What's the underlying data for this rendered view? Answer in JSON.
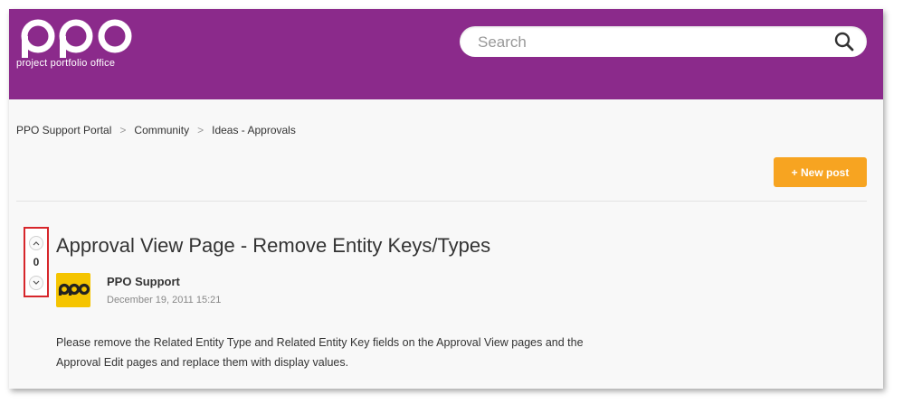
{
  "header": {
    "logo_text": "ppo",
    "logo_subtitle": "project portfolio office",
    "search_placeholder": "Search"
  },
  "breadcrumb": [
    "PPO Support Portal",
    "Community",
    "Ideas - Approvals"
  ],
  "breadcrumb_separator": ">",
  "actions": {
    "new_post_label": "+ New post"
  },
  "post": {
    "vote_count": "0",
    "title": "Approval View Page - Remove Entity Keys/Types",
    "author": "PPO Support",
    "date": "December 19, 2011 15:21",
    "body": "Please remove the Related Entity Type and Related Entity Key fields on the Approval View pages and the Approval Edit pages and replace them with display values."
  },
  "colors": {
    "header_bg": "#8b2a8b",
    "accent_button": "#f7a421",
    "highlight_box": "#d7262b",
    "avatar_bg": "#f5c400"
  },
  "icons": [
    "search-icon",
    "chevron-up-icon",
    "chevron-down-icon"
  ]
}
